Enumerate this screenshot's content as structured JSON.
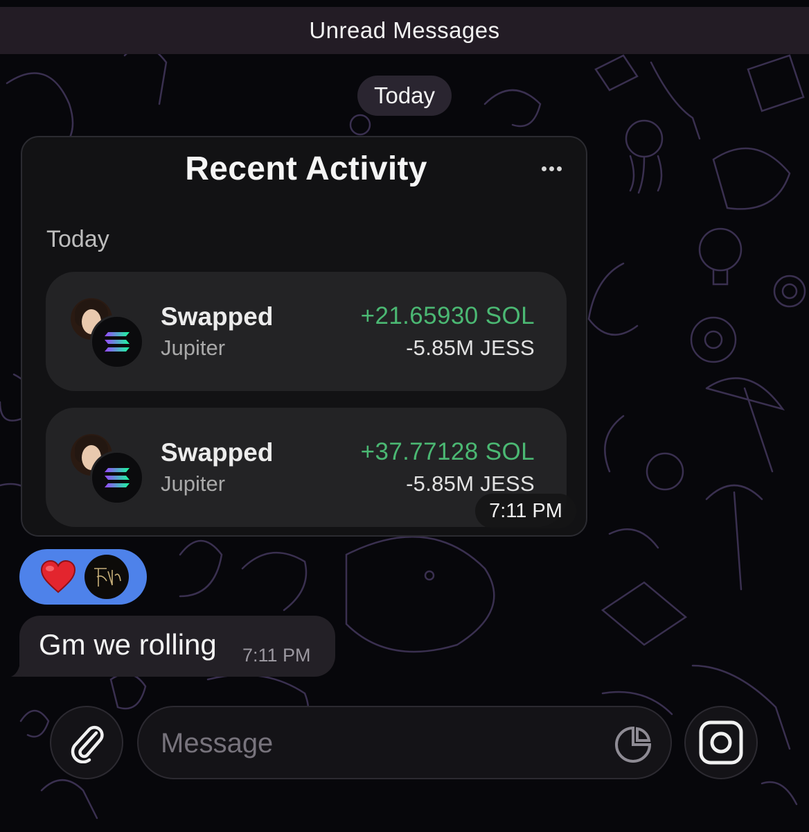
{
  "banner": {
    "unread_label": "Unread Messages"
  },
  "date_separator": "Today",
  "activity_card": {
    "title": "Recent Activity",
    "more_icon": "more-horizontal-icon",
    "section_label": "Today",
    "transactions": [
      {
        "title": "Swapped",
        "subtitle": "Jupiter",
        "amount_in": "+21.65930 SOL",
        "amount_out": "-5.85M JESS"
      },
      {
        "title": "Swapped",
        "subtitle": "Jupiter",
        "amount_in": "+37.77128 SOL",
        "amount_out": "-5.85M JESS"
      }
    ],
    "time": "7:11 PM"
  },
  "reaction": {
    "emoji": "heart-icon"
  },
  "message": {
    "text": "Gm we rolling",
    "time": "7:11 PM"
  },
  "composer": {
    "placeholder": "Message",
    "attach_icon": "paperclip-icon",
    "sticker_icon": "sticker-icon",
    "camera_icon": "camera-icon"
  },
  "colors": {
    "positive": "#4bb873",
    "reaction_bg": "#4e82ea",
    "banner_bg": "#231c25"
  }
}
